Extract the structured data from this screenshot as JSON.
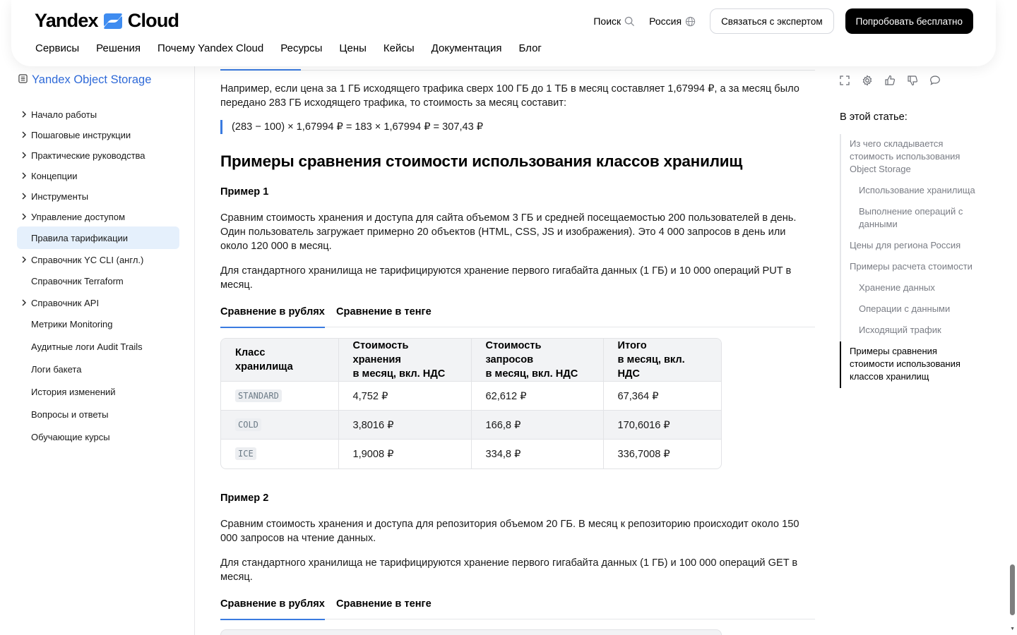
{
  "header": {
    "logo_left": "Yandex",
    "logo_right": "Cloud",
    "search_label": "Поиск",
    "region_label": "Россия",
    "contact_button": "Связаться с экспертом",
    "try_button": "Попробовать бесплатно",
    "nav": [
      "Сервисы",
      "Решения",
      "Почему Yandex Cloud",
      "Ресурсы",
      "Цены",
      "Кейсы",
      "Документация",
      "Блог"
    ]
  },
  "sidebar": {
    "title": "Yandex Object Storage",
    "items": [
      {
        "label": "Начало работы",
        "expandable": true
      },
      {
        "label": "Пошаговые инструкции",
        "expandable": true
      },
      {
        "label": "Практические руководства",
        "expandable": true
      },
      {
        "label": "Концепции",
        "expandable": true
      },
      {
        "label": "Инструменты",
        "expandable": true
      },
      {
        "label": "Управление доступом",
        "expandable": true
      },
      {
        "label": "Правила тарификации",
        "expandable": false,
        "active": true
      },
      {
        "label": "Справочник YC CLI (англ.)",
        "expandable": true
      },
      {
        "label": "Справочник Terraform",
        "expandable": false
      },
      {
        "label": "Справочник API",
        "expandable": true
      },
      {
        "label": "Метрики Monitoring",
        "expandable": false
      },
      {
        "label": "Аудитные логи Audit Trails",
        "expandable": false
      },
      {
        "label": "Логи бакета",
        "expandable": false
      },
      {
        "label": "История изменений",
        "expandable": false
      },
      {
        "label": "Вопросы и ответы",
        "expandable": false
      },
      {
        "label": "Обучающие курсы",
        "expandable": false
      }
    ]
  },
  "content": {
    "intro_paragraph": "Например, если цена за 1 ГБ исходящего трафика сверх 100 ГБ до 1 ТБ в месяц составляет 1,67994 ₽, а за месяц было передано 283 ГБ исходящего трафика, то стоимость за месяц составит:",
    "formula": "(283 − 100) × 1,67994 ₽ = 183 × 1,67994 ₽ = 307,43 ₽",
    "section_title": "Примеры сравнения стоимости использования классов хранилищ",
    "example1": {
      "title": "Пример 1",
      "paragraph1": "Сравним стоимость хранения и доступа для сайта объемом 3 ГБ и средней посещаемостью 200 пользователей в день. Один пользователь загружает примерно 20 объектов (HTML, CSS, JS и изображения). Это 4 000 запросов в день или около 120 000 в месяц.",
      "paragraph2": "Для стандартного хранилища не тарифицируются хранение первого гигабайта данных (1 ГБ) и 10 000 операций PUT в месяц.",
      "tabs": [
        "Сравнение в рублях",
        "Сравнение в тенге"
      ],
      "table": {
        "headers": [
          "Класс хранилища",
          "Стоимость хранения\nв месяц, вкл. НДС",
          "Стоимость запросов\nв месяц, вкл. НДС",
          "Итого\nв месяц, вкл. НДС"
        ],
        "rows": [
          [
            "STANDARD",
            "4,752 ₽",
            "62,612 ₽",
            "67,364 ₽"
          ],
          [
            "COLD",
            "3,8016 ₽",
            "166,8 ₽",
            "170,6016 ₽"
          ],
          [
            "ICE",
            "1,9008 ₽",
            "334,8 ₽",
            "336,7008 ₽"
          ]
        ]
      }
    },
    "example2": {
      "title": "Пример 2",
      "paragraph1": "Сравним стоимость хранения и доступа для репозитория объемом 20 ГБ. В месяц к репозиторию происходит около 150 000 запросов на чтение данных.",
      "paragraph2": "Для стандартного хранилища не тарифицируются хранение первого гигабайта данных (1 ГБ) и 100 000 операций GET в месяц.",
      "tabs": [
        "Сравнение в рублях",
        "Сравнение в тенге"
      ]
    }
  },
  "toc": {
    "title": "В этой статье:",
    "items": [
      {
        "label": "Из чего складывается стоимость использования Object Storage",
        "level": 1
      },
      {
        "label": "Использование хранилища",
        "level": 2
      },
      {
        "label": "Выполнение операций с данными",
        "level": 2
      },
      {
        "label": "Цены для региона Россия",
        "level": 1
      },
      {
        "label": "Примеры расчета стоимости",
        "level": 1
      },
      {
        "label": "Хранение данных",
        "level": 2
      },
      {
        "label": "Операции с данными",
        "level": 2
      },
      {
        "label": "Исходящий трафик",
        "level": 2
      },
      {
        "label": "Примеры сравнения стоимости использования классов хранилищ",
        "level": 1,
        "active": true
      }
    ],
    "toolbar_icons": [
      "fullscreen-icon",
      "settings-icon",
      "like-icon",
      "dislike-icon",
      "comment-icon"
    ]
  },
  "colors": {
    "accent": "#3a7be0",
    "active_bg": "#e5f0fc",
    "link": "#2f6ad8"
  }
}
